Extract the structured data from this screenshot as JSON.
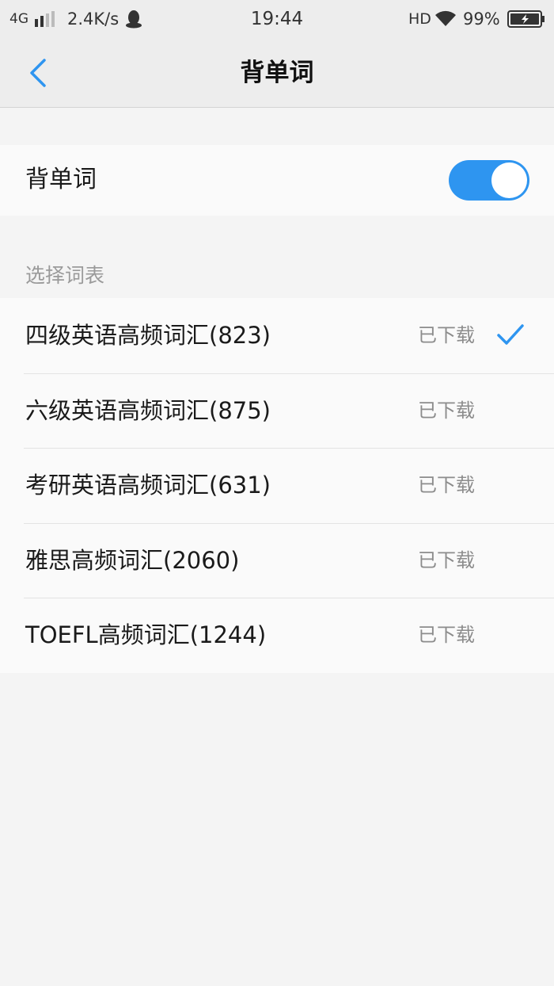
{
  "status_bar": {
    "network": "4G",
    "speed": "2.4K/s",
    "time": "19:44",
    "hd": "HD",
    "battery": "99%"
  },
  "nav": {
    "title": "背单词",
    "back_icon": "chevron-left-icon"
  },
  "toggle": {
    "label": "背单词",
    "enabled": true
  },
  "section": {
    "label": "选择词表"
  },
  "word_lists": [
    {
      "name": "四级英语高频词汇(823)",
      "status": "已下载",
      "selected": true
    },
    {
      "name": "六级英语高频词汇(875)",
      "status": "已下载",
      "selected": false
    },
    {
      "name": "考研英语高频词汇(631)",
      "status": "已下载",
      "selected": false
    },
    {
      "name": "雅思高频词汇(2060)",
      "status": "已下载",
      "selected": false
    },
    {
      "name": "TOEFL高频词汇(1244)",
      "status": "已下载",
      "selected": false
    }
  ],
  "colors": {
    "accent": "#2e95f0",
    "background": "#f4f4f4",
    "status_text": "#8c8c8c"
  }
}
